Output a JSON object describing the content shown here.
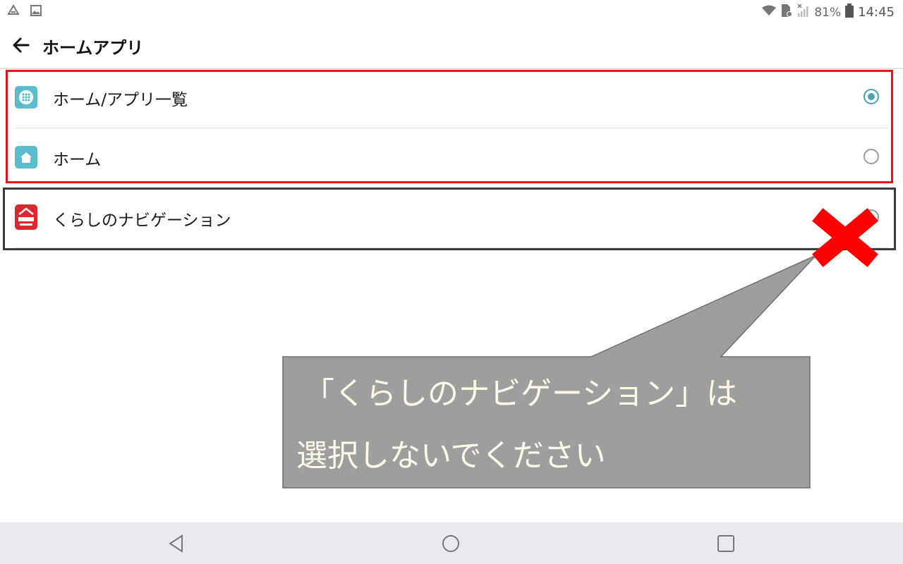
{
  "status_bar": {
    "battery_percent": "81%",
    "time": "14:45",
    "icons": [
      "drive-icon",
      "image-icon",
      "wifi-icon",
      "sim-icon",
      "signal-icon",
      "battery-icon"
    ]
  },
  "header": {
    "title": "ホームアプリ",
    "back_icon": "arrow-left-icon"
  },
  "home_apps": [
    {
      "label": "ホーム/アプリ一覧",
      "selected": true,
      "icon": "home-app-list-icon",
      "icon_color": "#5bbccd"
    },
    {
      "label": "ホーム",
      "selected": false,
      "icon": "home-icon",
      "icon_color": "#5bbccd"
    },
    {
      "label": "くらしのナビゲーション",
      "selected": false,
      "icon": "kurashi-nav-icon",
      "icon_color": "#e0262f"
    }
  ],
  "annotation": {
    "line1": "「くらしのナビゲーション」は",
    "line2": "選択しないでください",
    "box_color": "#9e9e9e",
    "cross_color": "#ff0000",
    "highlight_color": "#e8151b"
  },
  "nav_bar": {
    "icons": [
      "back-triangle-icon",
      "home-circle-icon",
      "recents-square-icon"
    ]
  }
}
